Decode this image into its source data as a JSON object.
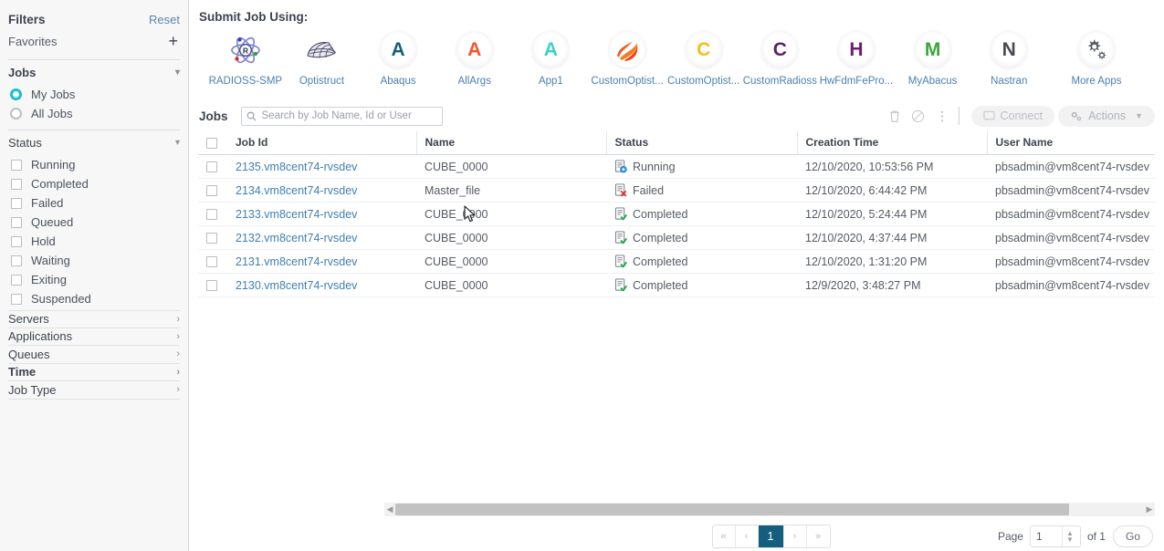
{
  "sidebar": {
    "filters_title": "Filters",
    "reset_label": "Reset",
    "favorites_label": "Favorites",
    "add_icon": "+",
    "jobs_group": {
      "title": "Jobs",
      "options": [
        {
          "label": "My Jobs",
          "selected": true
        },
        {
          "label": "All Jobs",
          "selected": false
        }
      ]
    },
    "status_group": {
      "title": "Status",
      "options": [
        {
          "label": "Running",
          "checked": false
        },
        {
          "label": "Completed",
          "checked": false
        },
        {
          "label": "Failed",
          "checked": false
        },
        {
          "label": "Queued",
          "checked": false
        },
        {
          "label": "Hold",
          "checked": false
        },
        {
          "label": "Waiting",
          "checked": false
        },
        {
          "label": "Exiting",
          "checked": false
        },
        {
          "label": "Suspended",
          "checked": false
        }
      ]
    },
    "accordions": [
      {
        "label": "Servers",
        "bold": false
      },
      {
        "label": "Applications",
        "bold": false
      },
      {
        "label": "Queues",
        "bold": false
      },
      {
        "label": "Time",
        "bold": true
      },
      {
        "label": "Job Type",
        "bold": false
      }
    ]
  },
  "main": {
    "submit_title": "Submit Job Using:",
    "apps": [
      {
        "label": "RADIOSS-SMP",
        "icon": "atom-r-icon",
        "glyph": "",
        "color": "#7b7fc4"
      },
      {
        "label": "Optistruct",
        "icon": "mesh-icon",
        "glyph": "",
        "color": "#4a4a68"
      },
      {
        "label": "Abaqus",
        "icon": "letter-a-icon",
        "glyph": "A",
        "color": "#15607a"
      },
      {
        "label": "AllArgs",
        "icon": "letter-a-icon",
        "glyph": "A",
        "color": "#f4542a"
      },
      {
        "label": "App1",
        "icon": "letter-a-icon",
        "glyph": "A",
        "color": "#3ecfcf"
      },
      {
        "label": "CustomOptist...",
        "icon": "swirl-icon",
        "glyph": "",
        "color": "#ee5a24"
      },
      {
        "label": "CustomOptist...",
        "icon": "letter-c-icon",
        "glyph": "C",
        "color": "#f5bd18"
      },
      {
        "label": "CustomRadioss",
        "icon": "letter-c-icon",
        "glyph": "C",
        "color": "#5b2366"
      },
      {
        "label": "HwFdmFePro...",
        "icon": "letter-h-icon",
        "glyph": "H",
        "color": "#6b1f6e"
      },
      {
        "label": "MyAbacus",
        "icon": "letter-m-icon",
        "glyph": "M",
        "color": "#3aa63a"
      },
      {
        "label": "Nastran",
        "icon": "letter-n-icon",
        "glyph": "N",
        "color": "#4a4a52"
      },
      {
        "label": "More Apps",
        "icon": "gears-icon",
        "glyph": "",
        "color": "#555b66"
      }
    ],
    "jobs_label": "Jobs",
    "search": {
      "placeholder": "Search by Job Name, Id or User",
      "value": ""
    },
    "toolbar": {
      "delete_icon": "trash-icon",
      "cancel_icon": "ban-icon",
      "more_icon": "vertical-dots-icon",
      "connect_label": "Connect",
      "actions_label": "Actions"
    },
    "table": {
      "columns": [
        "Job Id",
        "Name",
        "Status",
        "Creation Time",
        "User Name"
      ],
      "rows": [
        {
          "job_id": "2135.vm8cent74-rvsdev",
          "name": "CUBE_0000",
          "status": "Running",
          "status_icon": "running-icon",
          "creation_time": "12/10/2020, 10:53:56 PM",
          "user_name": "pbsadmin@vm8cent74-rvsdev"
        },
        {
          "job_id": "2134.vm8cent74-rvsdev",
          "name": "Master_file",
          "status": "Failed",
          "status_icon": "failed-icon",
          "creation_time": "12/10/2020, 6:44:42 PM",
          "user_name": "pbsadmin@vm8cent74-rvsdev"
        },
        {
          "job_id": "2133.vm8cent74-rvsdev",
          "name": "CUBE_0000",
          "status": "Completed",
          "status_icon": "completed-icon",
          "creation_time": "12/10/2020, 5:24:44 PM",
          "user_name": "pbsadmin@vm8cent74-rvsdev"
        },
        {
          "job_id": "2132.vm8cent74-rvsdev",
          "name": "CUBE_0000",
          "status": "Completed",
          "status_icon": "completed-icon",
          "creation_time": "12/10/2020, 4:37:44 PM",
          "user_name": "pbsadmin@vm8cent74-rvsdev"
        },
        {
          "job_id": "2131.vm8cent74-rvsdev",
          "name": "CUBE_0000",
          "status": "Completed",
          "status_icon": "completed-icon",
          "creation_time": "12/10/2020, 1:31:20 PM",
          "user_name": "pbsadmin@vm8cent74-rvsdev"
        },
        {
          "job_id": "2130.vm8cent74-rvsdev",
          "name": "CUBE_0000",
          "status": "Completed",
          "status_icon": "completed-icon",
          "creation_time": "12/9/2020, 3:48:27 PM",
          "user_name": "pbsadmin@vm8cent74-rvsdev"
        }
      ]
    },
    "pagination": {
      "first": "«",
      "prev": "‹",
      "current_page": "1",
      "next": "›",
      "last": "»",
      "page_label": "Page",
      "page_value": "1",
      "of_label": "of 1",
      "go_label": "Go"
    }
  },
  "colors": {
    "accent_teal": "#17c1ce",
    "link_blue": "#3f7fb3",
    "page_active": "#155e7d",
    "sidebar_bg": "#f7f7f7"
  }
}
